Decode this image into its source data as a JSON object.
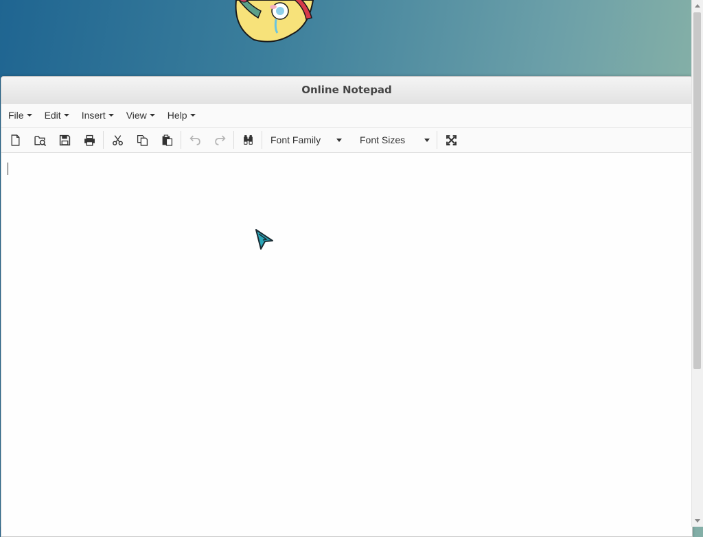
{
  "window": {
    "title": "Online Notepad"
  },
  "menu": [
    {
      "label": "File"
    },
    {
      "label": "Edit"
    },
    {
      "label": "Insert"
    },
    {
      "label": "View"
    },
    {
      "label": "Help"
    }
  ],
  "toolbar": {
    "buttons": [
      {
        "icon": "new-document-icon"
      },
      {
        "icon": "open-file-icon"
      },
      {
        "icon": "save-icon"
      },
      {
        "icon": "print-icon"
      },
      {
        "icon": "cut-icon"
      },
      {
        "icon": "copy-icon"
      },
      {
        "icon": "paste-icon"
      },
      {
        "icon": "undo-icon",
        "disabled": true
      },
      {
        "icon": "redo-icon",
        "disabled": true
      },
      {
        "icon": "find-icon"
      },
      {
        "icon": "fullscreen-icon"
      }
    ],
    "font_family_label": "Font Family",
    "font_sizes_label": "Font Sizes"
  },
  "editor": {
    "content": ""
  },
  "colors": {
    "desktop_gradient_start": "#1f6591",
    "desktop_gradient_end": "#93b9a6",
    "cursor_accent": "#2aa6b8"
  }
}
